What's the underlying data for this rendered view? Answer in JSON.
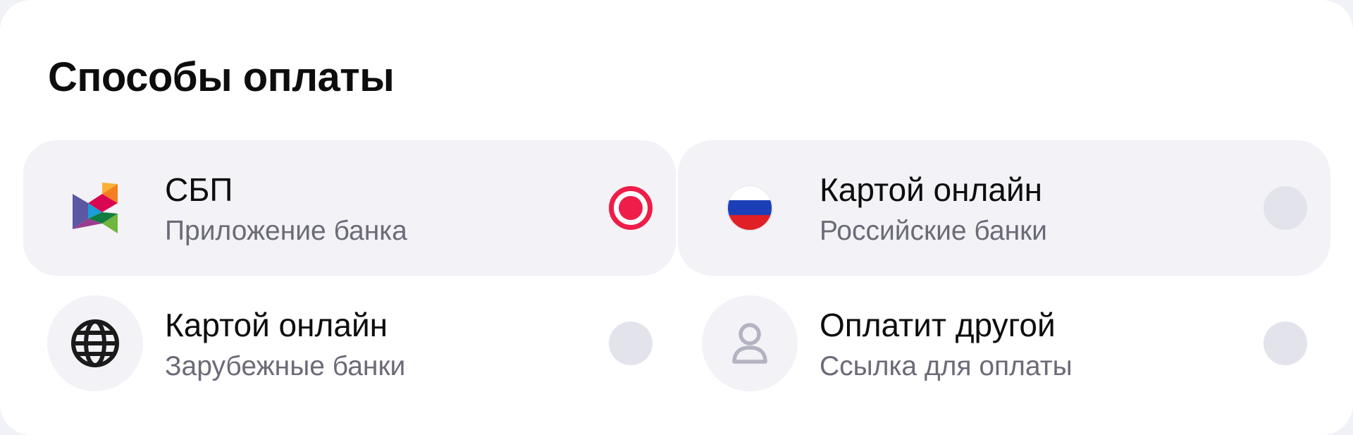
{
  "section": {
    "title": "Способы оплаты"
  },
  "options": [
    {
      "title": "СБП",
      "subtitle": "Приложение банка",
      "icon": "sbp-logo-icon",
      "selected": true
    },
    {
      "title": "Картой онлайн",
      "subtitle": "Российские банки",
      "icon": "russia-flag-icon",
      "selected": false
    },
    {
      "title": "Картой онлайн",
      "subtitle": "Зарубежные банки",
      "icon": "globe-icon",
      "selected": false
    },
    {
      "title": "Оплатит другой",
      "subtitle": "Ссылка для оплаты",
      "icon": "person-icon",
      "selected": false
    }
  ],
  "colors": {
    "accent": "#ee1d49",
    "selected_row_bg": "#f2f2f7",
    "radio_unselected": "#e3e3ec",
    "subtitle": "#6b6b78"
  }
}
